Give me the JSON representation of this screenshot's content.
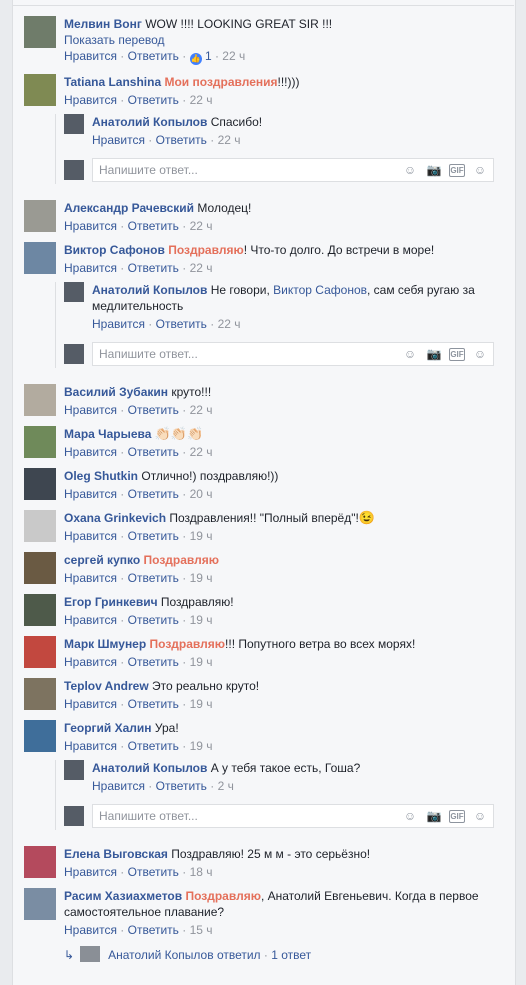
{
  "actions": {
    "like": "Нравится",
    "reply": "Ответить",
    "translate": "Показать перевод"
  },
  "composer_placeholder": "Напишите ответ...",
  "comments": [
    {
      "author": "Мелвин Вонг",
      "text": "WOW !!!! LOOKING GREAT SIR !!!",
      "likes": "1",
      "time": "22 ч"
    },
    {
      "author": "Tatiana Lanshina",
      "tag": "Мои поздравления",
      "text": "!!!)))",
      "time": "22 ч"
    },
    {
      "author": "Александр Рачевский",
      "text": "Молодец!",
      "time": "22 ч"
    },
    {
      "author": "Виктор Сафонов",
      "tag": "Поздравляю",
      "text": "! Что-то долго. До встречи в море!",
      "time": "22 ч"
    },
    {
      "author": "Василий Зубакин",
      "text": "круто!!!",
      "time": "22 ч"
    },
    {
      "author": "Мара Чарыева",
      "text": "👏🏻👏🏻👏🏻",
      "time": "22 ч"
    },
    {
      "author": "Oleg Shutkin",
      "text": "Отлично!) поздравляю!))",
      "time": "20 ч"
    },
    {
      "author": "Oxana Grinkevich",
      "text": "Поздравления!! \"Полный вперёд\"!",
      "emoji": "😉",
      "time": "19 ч"
    },
    {
      "author": "сергей купко",
      "tag": "Поздравляю",
      "text": "",
      "time": "19 ч"
    },
    {
      "author": "Егор Гринкевич",
      "text": "Поздравляю!",
      "time": "19 ч"
    },
    {
      "author": "Марк Шмунер",
      "tag": "Поздравляю",
      "text": "!!! Попутного ветра во всех морях!",
      "time": "19 ч"
    },
    {
      "author": "Teplov Andrew",
      "text": "Это реально круто!",
      "time": "19 ч"
    },
    {
      "author": "Георгий Халин",
      "text": "Ура!",
      "time": "19 ч"
    },
    {
      "author": "Елена Выговская",
      "text": "Поздравляю! 25 м м - это серьёзно!",
      "time": "18 ч"
    },
    {
      "author": "Расим Хазиахметов",
      "tag": "Поздравляю",
      "text": ", Анатолий Евгеньевич. Когда в первое самостоятельное плавание?",
      "time": "15 ч"
    }
  ],
  "replies": [
    {
      "author": "Анатолий Копылов",
      "text": "Спасибо!",
      "time": "22 ч"
    },
    {
      "author": "Анатолий Копылов",
      "text_before": "Не говори,",
      "mention": "Виктор Сафонов",
      "text_after": ", сам себя ругаю за медлительность",
      "time": "22 ч"
    },
    {
      "author": "Анатолий Копылов",
      "text": "А у тебя такое есть, Гоша?",
      "time": "2 ч"
    }
  ],
  "replies_summary": {
    "author": "Анатолий Копылов",
    "text": "ответил",
    "count": "1 ответ"
  }
}
